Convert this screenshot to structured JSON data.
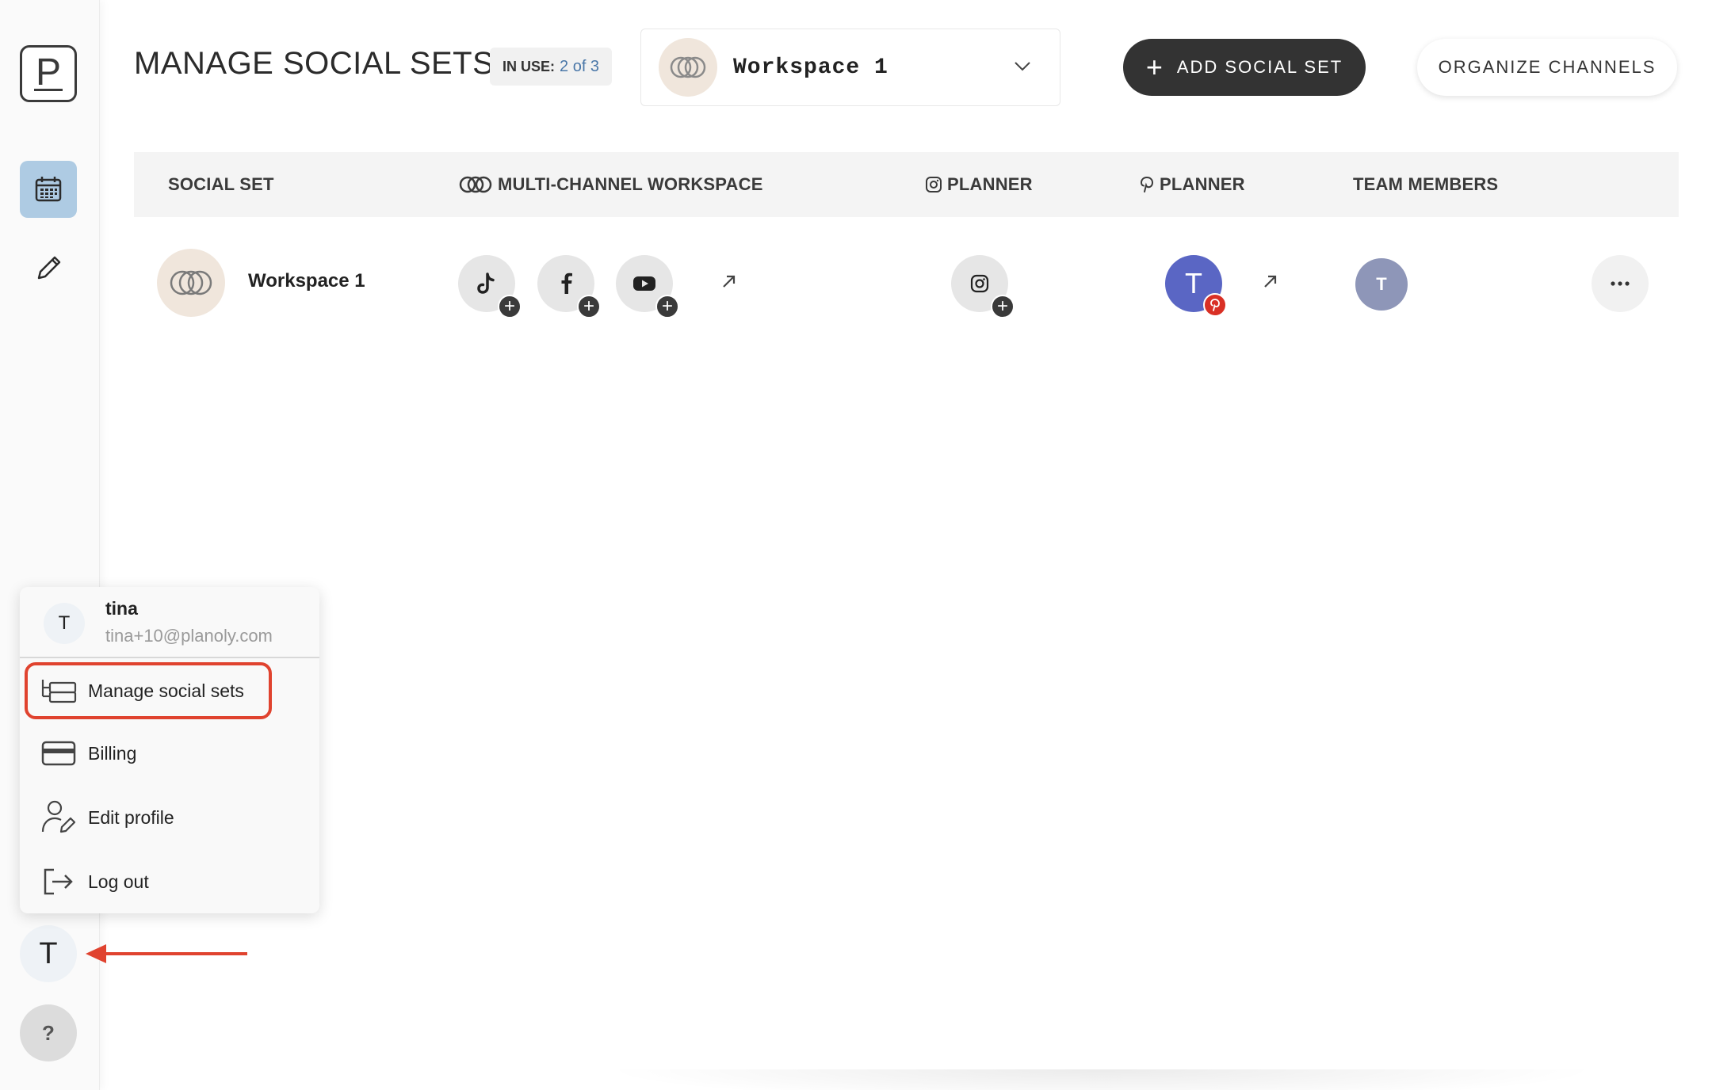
{
  "sidebar": {
    "logo_letter": "P",
    "nav": [
      "calendar-icon",
      "pencil-icon"
    ],
    "user_avatar_letter": "T",
    "help_label": "?"
  },
  "header": {
    "title": "MANAGE SOCIAL SETS",
    "in_use_label": "IN USE:",
    "in_use_value": "2 of 3",
    "workspace_name": "Workspace 1",
    "add_button": "ADD SOCIAL SET",
    "organize_button": "ORGANIZE CHANNELS"
  },
  "table": {
    "columns": [
      "SOCIAL SET",
      "MULTI-CHANNEL WORKSPACE",
      "PLANNER",
      "PLANNER",
      "TEAM MEMBERS"
    ],
    "rows": [
      {
        "name": "Workspace 1",
        "channels": [
          "tiktok-icon",
          "facebook-icon",
          "youtube-icon"
        ],
        "instagram": "instagram-icon",
        "pinterest_avatar": "T",
        "team_member": "T"
      }
    ]
  },
  "user_menu": {
    "avatar_letter": "T",
    "name": "tina",
    "email": "tina+10@planoly.com",
    "items": [
      "Manage social sets",
      "Billing",
      "Edit profile",
      "Log out"
    ]
  },
  "colors": {
    "highlight": "#e0432f",
    "accent": "#aecbe3",
    "pinterest": "#d93025",
    "avatar": "#5a66c4"
  }
}
